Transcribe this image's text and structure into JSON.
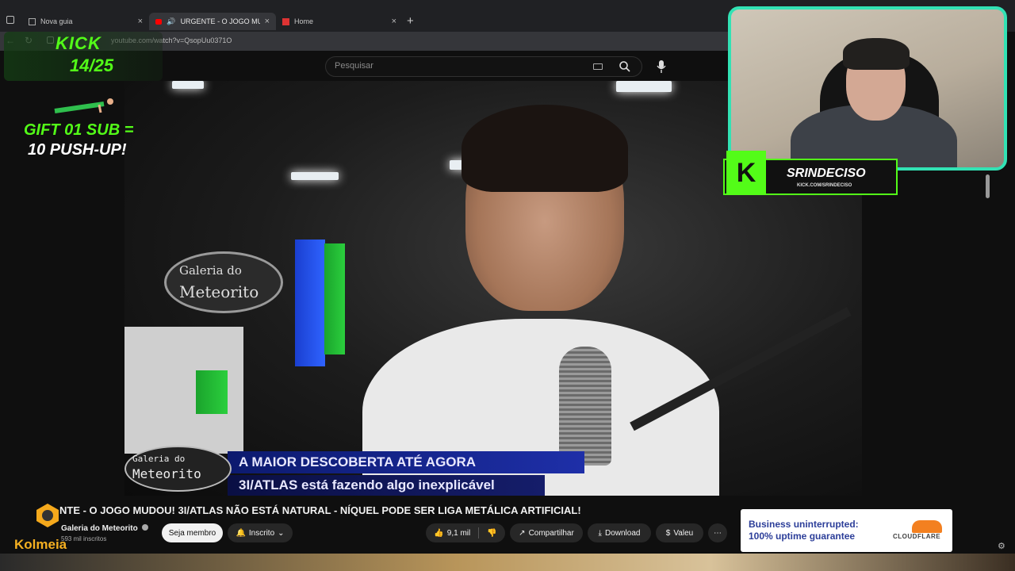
{
  "browser": {
    "tabs": [
      {
        "label": "Nova guia"
      },
      {
        "label": "URGENTE - O JOGO MUDOU"
      },
      {
        "label": "Home"
      }
    ],
    "url": "youtube.com/watch?v=QsopUu0371O"
  },
  "youtube": {
    "search_placeholder": "Pesquisar"
  },
  "overlay": {
    "kick_logo": "KICK",
    "goal": "14/25",
    "gift_line1": "GIFT 01 SUB =",
    "gift_line2": "10 PUSH-UP!",
    "streamer_name": "SRINDECISO",
    "streamer_url": "KICK.COM/SRINDECISO"
  },
  "video": {
    "studio_logo_line1": "Galeria do",
    "studio_logo_line2": "Meteorito",
    "lower_third_line1": "A MAIOR DESCOBERTA ATÉ AGORA",
    "lower_third_line2": "3I/ATLAS está fazendo algo inexplicável",
    "lower_third_logo_line1": "Galeria do",
    "lower_third_logo_line2": "Meteorito"
  },
  "meta": {
    "title": "NTE - O JOGO MUDOU! 3I/ATLAS NÃO ESTÁ NATURAL - NÍQUEL PODE SER LIGA METÁLICA ARTIFICIAL!",
    "channel_name": "Galeria do Meteorito",
    "subscribers": "593 mil inscritos",
    "watermark": "Kolmeia",
    "join_label": "Seja membro",
    "subscribed_label": "Inscrito",
    "likes": "9,1 mil",
    "share_label": "Compartilhar",
    "download_label": "Download",
    "thanks_label": "Valeu"
  },
  "ad": {
    "text": "Business uninterrupted: 100% uptime guarantee",
    "brand": "CLOUDFLARE"
  },
  "colors": {
    "kick_green": "#53fc18",
    "cam_border": "#32e2b4",
    "cloudflare_orange": "#f38020"
  }
}
